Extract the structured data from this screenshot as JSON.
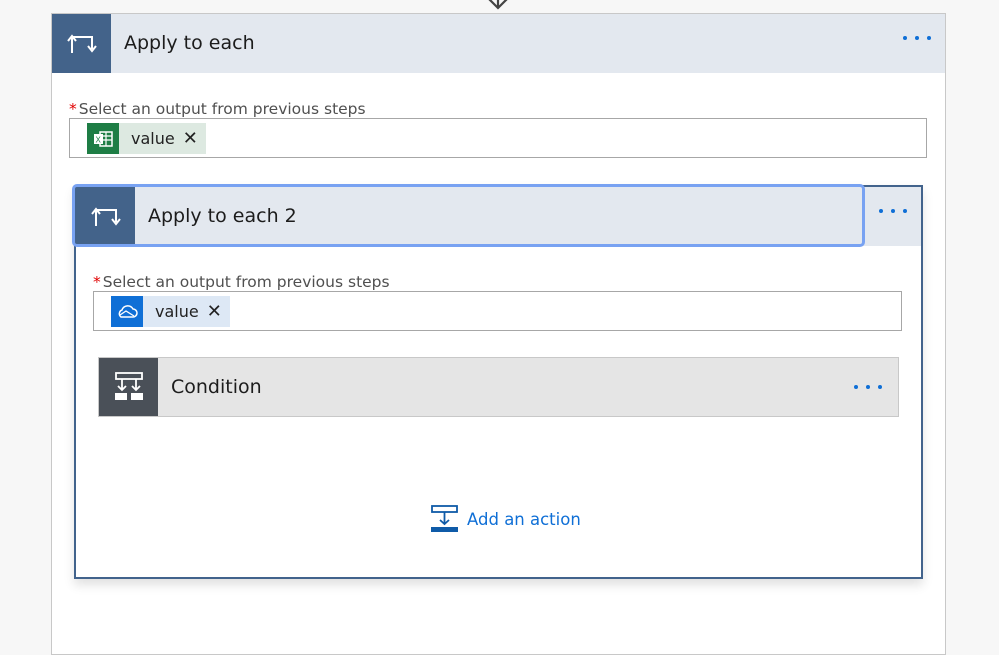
{
  "outer_step": {
    "title": "Apply to each",
    "icon": "loop-icon",
    "menu_icon": "more-options-icon",
    "field_label": "Select an output from previous steps",
    "required_mark": "*",
    "token": {
      "label": "value",
      "icon": "excel-icon",
      "remove": "✕",
      "icon_color": "#1e7d45",
      "bg": "#dde9e1"
    }
  },
  "inner_step": {
    "title": "Apply to each 2",
    "icon": "loop-icon",
    "menu_icon": "more-options-icon",
    "field_label": "Select an output from previous steps",
    "required_mark": "*",
    "token": {
      "label": "value",
      "icon": "onedrive-icon",
      "remove": "✕",
      "icon_color": "#0f6fd6",
      "bg": "#dde8f5"
    },
    "condition": {
      "title": "Condition",
      "icon": "condition-icon",
      "menu_icon": "more-options-icon"
    },
    "add_action": {
      "label": "Add an action",
      "icon": "add-action-icon"
    }
  },
  "colors": {
    "accent": "#0f6fd6",
    "loop_header": "#43638a",
    "condition_header": "#4a5058",
    "focus": "#78a2f2"
  }
}
